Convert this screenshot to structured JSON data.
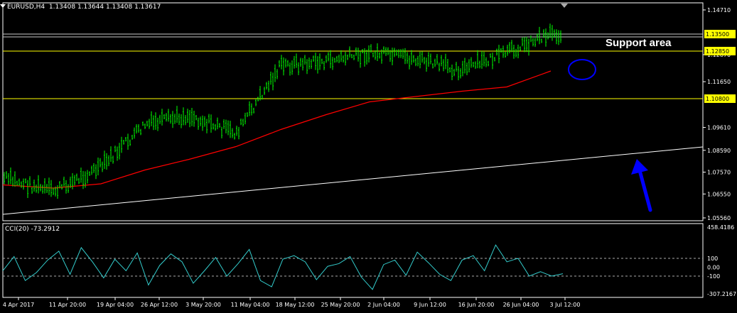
{
  "header": {
    "symbol": "EURUSD,H4",
    "ohlc": "1.13408 1.13644 1.13408 1.13617"
  },
  "indicator": {
    "name": "CCI(20)",
    "value": "-73.2912"
  },
  "annotation": "Support area",
  "colors": {
    "background": "#000000",
    "candles": "#00ff00",
    "moving_average": "#ff0000",
    "support_lines": "#ffff00",
    "trendline": "#ffffff",
    "cci": "#33cccc",
    "circle": "#0000ff",
    "arrow": "#0000ff"
  },
  "chart_data": [
    {
      "type": "line",
      "title": "EURUSD,H4",
      "ylim": [
        1.0556,
        1.1471
      ],
      "y_ticks": [
        "1.14710",
        "1.12870",
        "1.11650",
        "1.09610",
        "1.08590",
        "1.07570",
        "1.06550",
        "1.05560"
      ],
      "x_ticks": [
        "4 Apr 2017",
        "11 Apr 20:00",
        "19 Apr 04:00",
        "26 Apr 12:00",
        "3 May 20:00",
        "11 May 04:00",
        "18 May 12:00",
        "25 May 20:00",
        "2 Jun 04:00",
        "9 Jun 12:00",
        "16 Jun 20:00",
        "26 Jun 04:00",
        "3 Jul 12:00"
      ],
      "price_lines": [
        {
          "label": "1.13500",
          "value": 1.135
        },
        {
          "label": "1.12850",
          "value": 1.1285
        },
        {
          "label": "1.10800",
          "value": 1.108
        }
      ],
      "price_series": {
        "name": "EURUSD,H4",
        "x": [
          "4 Apr 2017",
          "11 Apr 20:00",
          "19 Apr 04:00",
          "26 Apr 12:00",
          "3 May 20:00",
          "11 May 04:00",
          "18 May 12:00",
          "25 May 20:00",
          "2 Jun 04:00",
          "9 Jun 12:00",
          "16 Jun 20:00",
          "26 Jun 04:00",
          "3 Jul 12:00"
        ],
        "y": [
          1.067,
          1.0605,
          1.072,
          1.092,
          1.0965,
          1.088,
          1.12,
          1.122,
          1.126,
          1.123,
          1.118,
          1.126,
          1.136
        ]
      },
      "ma_series": {
        "x": [
          "4 Apr 2017",
          "11 Apr 20:00",
          "19 Apr 04:00",
          "26 Apr 12:00",
          "3 May 20:00",
          "11 May 04:00",
          "18 May 12:00",
          "25 May 20:00",
          "2 Jun 04:00",
          "9 Jun 12:00",
          "16 Jun 20:00",
          "26 Jun 04:00",
          "3 Jul 12:00"
        ],
        "y": [
          1.068,
          1.0665,
          1.0685,
          1.075,
          1.08,
          1.086,
          1.094,
          1.101,
          1.107,
          1.1095,
          1.112,
          1.114,
          1.1215
        ]
      },
      "trendline": {
        "y_start": 1.059,
        "y_end": 1.0885
      },
      "grid": false
    },
    {
      "type": "line",
      "title": "CCI(20) -73.2912",
      "ylim": [
        -307.2167,
        458.4186
      ],
      "y_ticks": [
        "458.4186",
        "100",
        "0.00",
        "-100",
        "-307.2167"
      ],
      "levels": [
        100,
        -100
      ],
      "series": [
        {
          "name": "CCI(20)",
          "values": [
            -40,
            120,
            -150,
            -60,
            80,
            180,
            -80,
            220,
            60,
            -120,
            90,
            -40,
            160,
            -200,
            20,
            150,
            60,
            -180,
            -40,
            110,
            -100,
            40,
            200,
            -150,
            -220,
            90,
            130,
            60,
            -140,
            10,
            40,
            120,
            -110,
            -250,
            30,
            80,
            -90,
            170,
            50,
            -80,
            -150,
            80,
            130,
            -40,
            250,
            60,
            100,
            -100,
            -50,
            -100,
            -73
          ]
        }
      ]
    }
  ]
}
